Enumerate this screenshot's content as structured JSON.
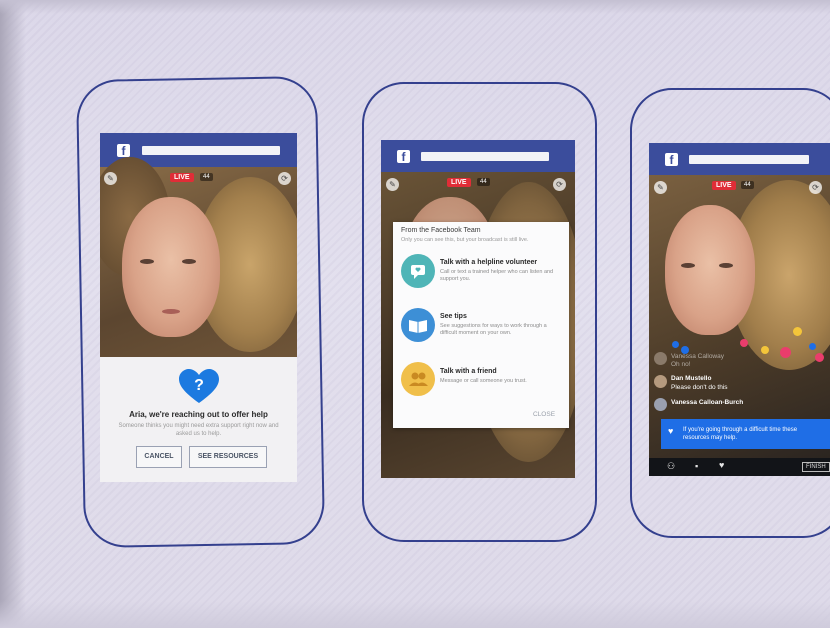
{
  "phone1": {
    "live_label": "LIVE",
    "viewers": "44",
    "help_title": "Aria, we're reaching out to offer help",
    "help_subtitle": "Someone thinks you might need extra support right now and asked us to help.",
    "cancel_label": "CANCEL",
    "resources_label": "SEE RESOURCES",
    "heart_symbol": "?"
  },
  "phone2": {
    "live_label": "LIVE",
    "viewers": "44",
    "sheet_header": "From the Facebook Team",
    "sheet_note": "Only you can see this, but your broadcast is still live.",
    "options": [
      {
        "title": "Talk with a helpline volunteer",
        "desc": "Call or text a trained helper who can listen and support you.",
        "color": "#4fb5b7"
      },
      {
        "title": "See tips",
        "desc": "See suggestions for ways to work through a difficult moment on your own.",
        "color": "#3d8fd6"
      },
      {
        "title": "Talk with a friend",
        "desc": "Message or call someone you trust.",
        "color": "#f0bf4a"
      }
    ],
    "close_label": "CLOSE"
  },
  "phone3": {
    "live_label": "LIVE",
    "viewers": "44",
    "comments": [
      {
        "name": "Vanessa Calloway",
        "text": "Oh no!"
      },
      {
        "name": "Dan Mustello",
        "text": "Please don't do this"
      },
      {
        "name": "Vanessa Calloan-Burch",
        "text": ""
      }
    ],
    "banner_text": "If you're going through a difficult time these resources may help.",
    "finish_label": "FINISH"
  },
  "colors": {
    "facebook_blue": "#3b4d9c",
    "live_red": "#e02d37",
    "help_blue": "#1f6ee6",
    "outline": "#34408e"
  }
}
